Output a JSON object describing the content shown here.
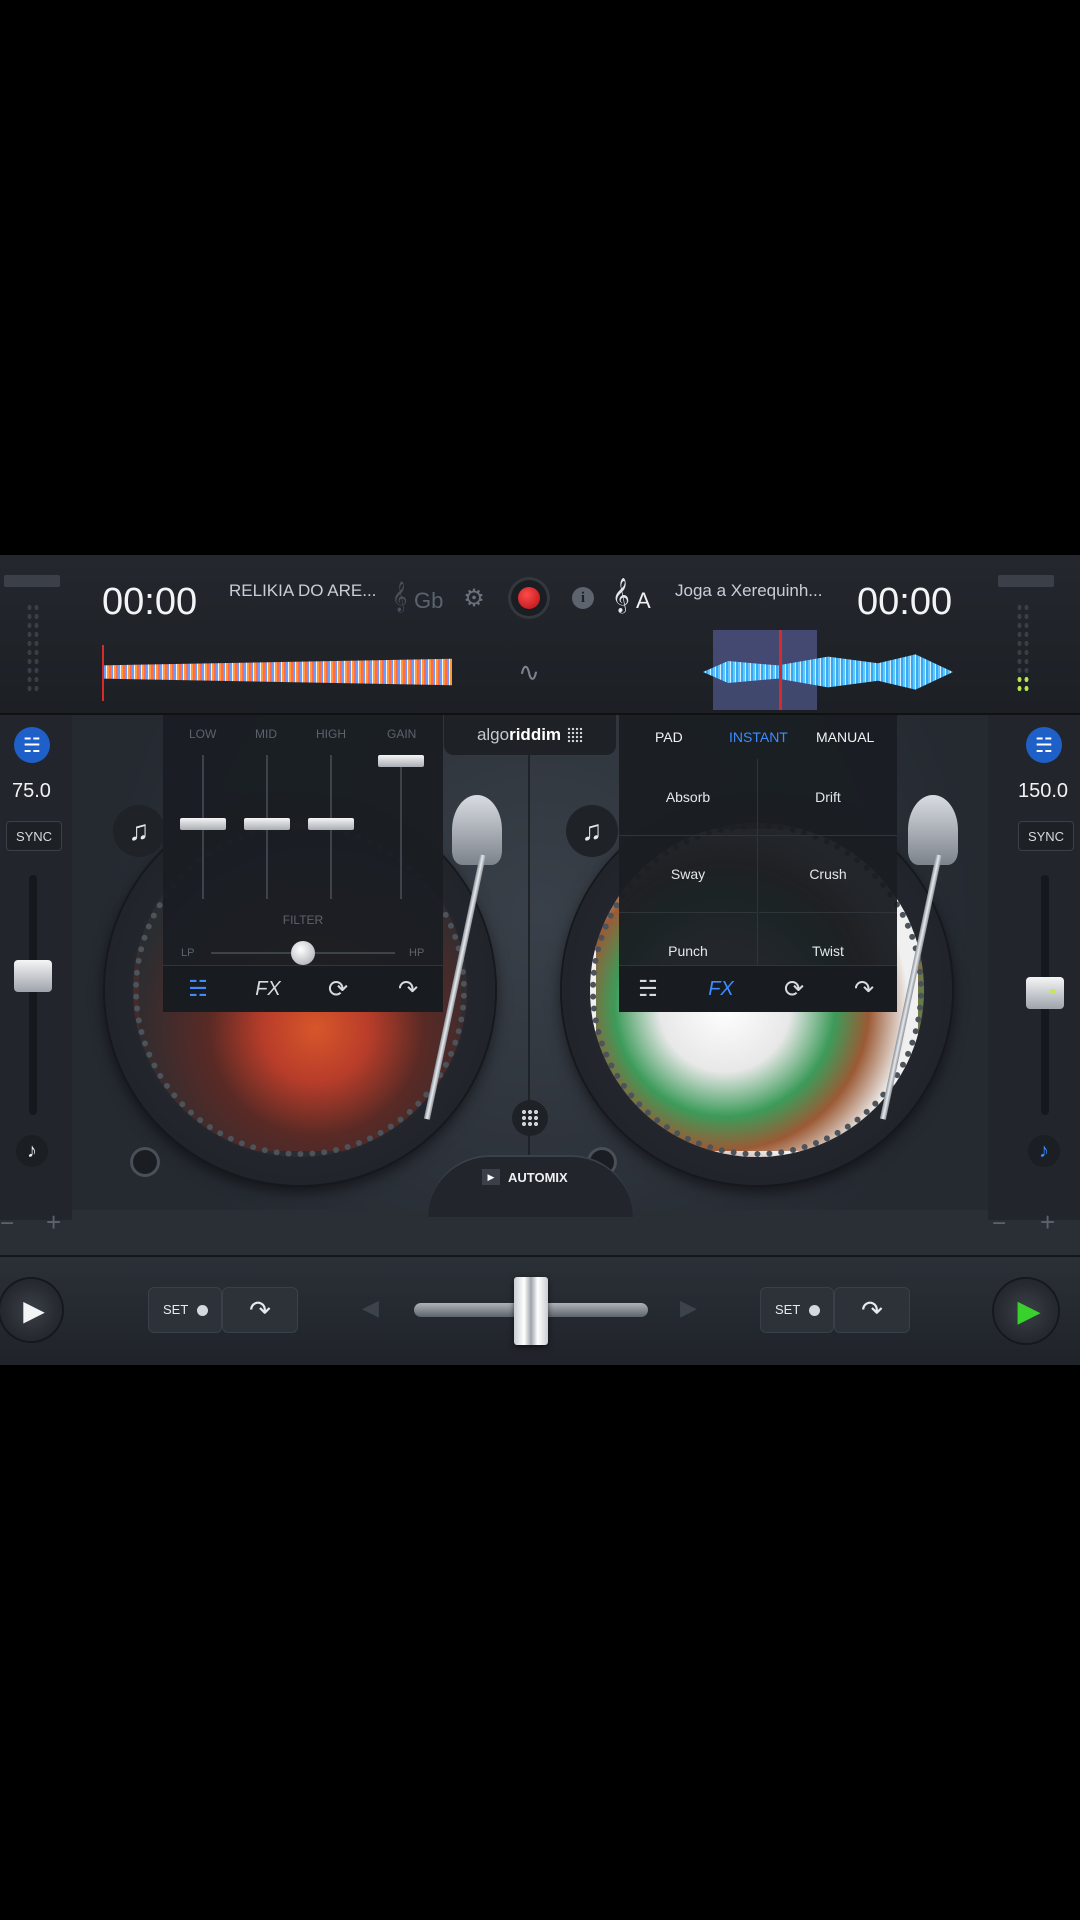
{
  "left_deck": {
    "time": "00:00",
    "track": "RELIKIA DO ARE...",
    "key": "Gb",
    "bpm": "75.0",
    "sync": "SYNC",
    "eq": {
      "low": "LOW",
      "mid": "MID",
      "high": "HIGH",
      "gain": "GAIN",
      "filter": "FILTER",
      "lp": "LP",
      "hp": "HP"
    },
    "set": "SET"
  },
  "right_deck": {
    "time": "00:00",
    "track": "Joga a Xerequinh...",
    "key": "A",
    "bpm": "150.0",
    "sync": "SYNC",
    "fx_tabs": [
      "PAD",
      "INSTANT",
      "MANUAL"
    ],
    "fx": [
      "Absorb",
      "Drift",
      "Sway",
      "Crush",
      "Punch",
      "Twist"
    ],
    "set": "SET"
  },
  "brand": {
    "algo": "algo",
    "riddim": "riddim"
  },
  "automix": "AUTOMIX",
  "panel_icons": [
    "mixer-icon",
    "fx-icon",
    "loop-icon",
    "redo-icon"
  ],
  "fx_label": "FX",
  "crossfader_position": 0.5,
  "colors": {
    "accent": "#3d8cff",
    "record": "#c8161c",
    "play": "#39d12c"
  }
}
